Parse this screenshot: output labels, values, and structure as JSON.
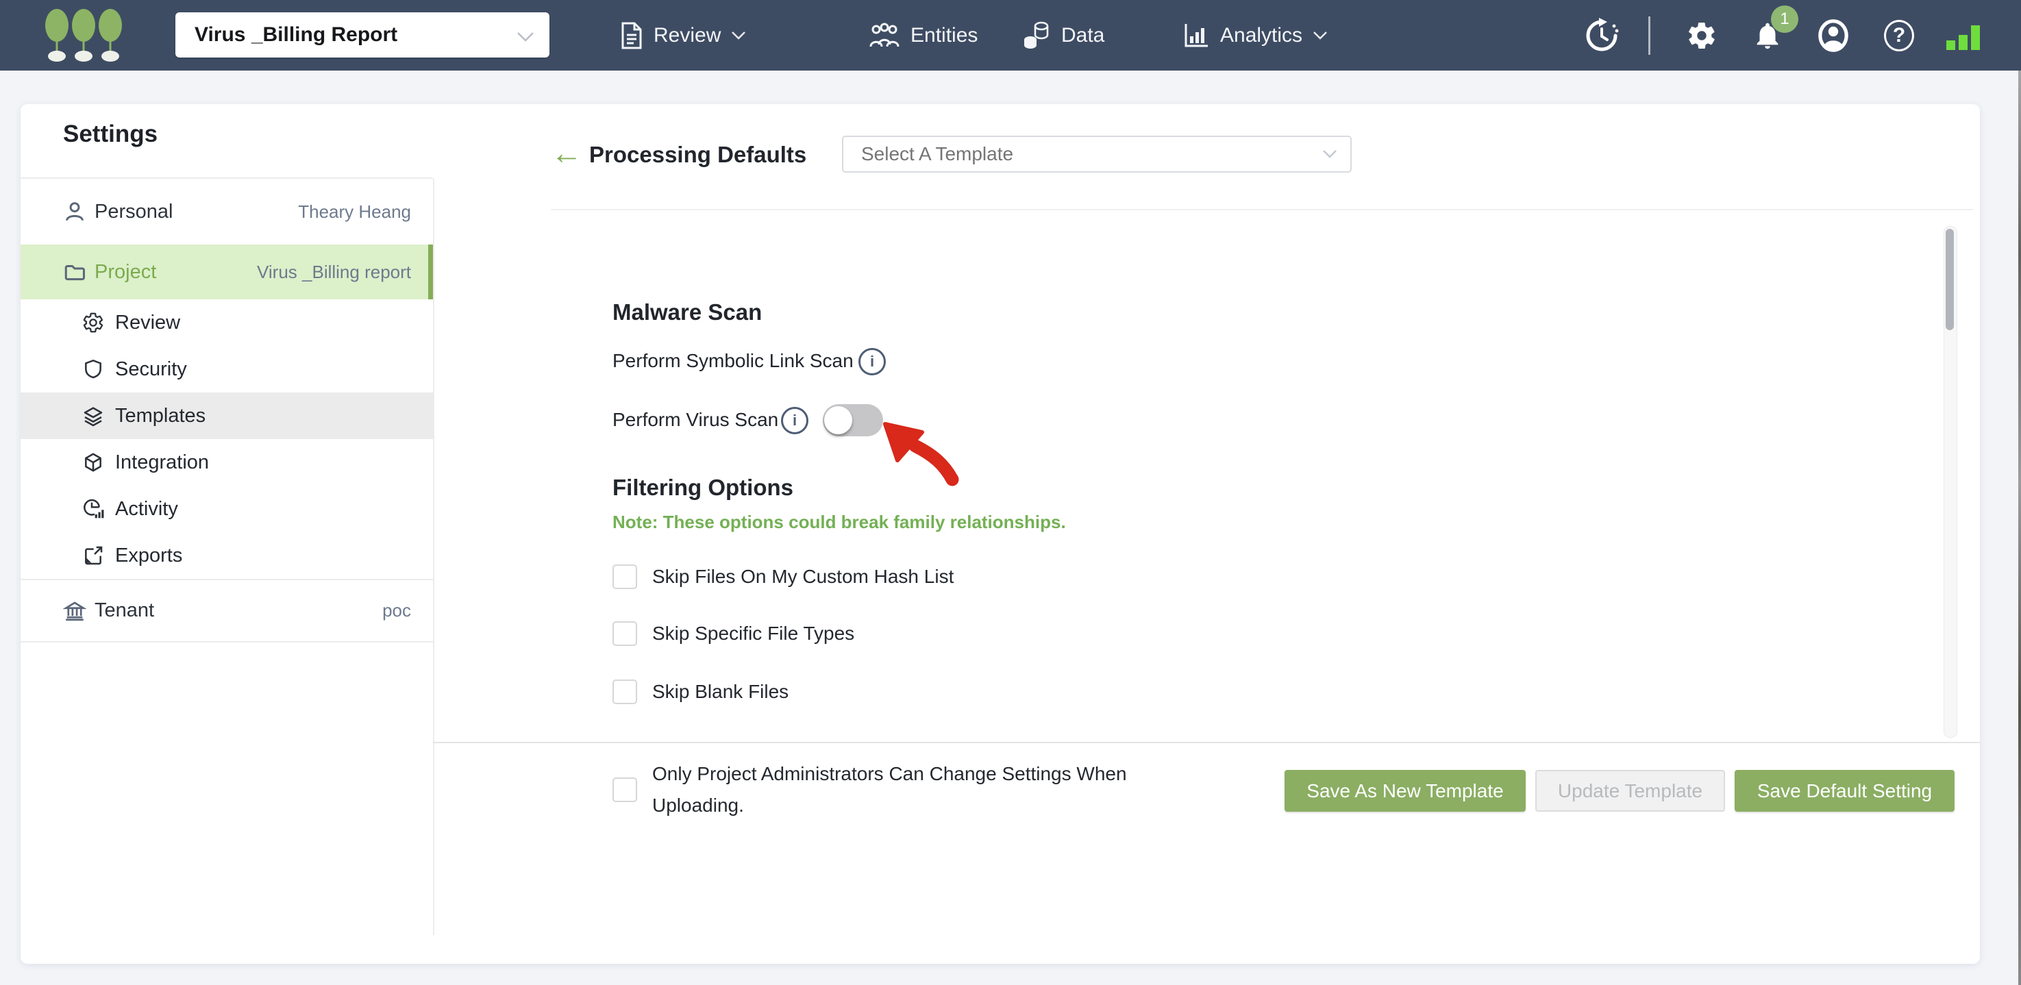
{
  "top_bar": {
    "project_selector_value": "Virus _Billing Report",
    "nav": [
      "Review",
      "Entities",
      "Data",
      "Analytics"
    ],
    "notification_badge": "1"
  },
  "sidebar": {
    "title": "Settings",
    "personal": {
      "label": "Personal",
      "value": "Theary Heang"
    },
    "project": {
      "label": "Project",
      "value": "Virus _Billing report"
    },
    "subitems": [
      "Review",
      "Security",
      "Templates",
      "Integration",
      "Activity",
      "Exports"
    ],
    "tenant": {
      "label": "Tenant",
      "value": "poc"
    }
  },
  "main": {
    "title": "Processing Defaults",
    "template_dropdown_placeholder": "Select A Template",
    "malware": {
      "heading": "Malware Scan",
      "symbolic_label": "Perform Symbolic Link Scan",
      "virus_label": "Perform Virus Scan",
      "virus_toggle_state": "off"
    },
    "filtering": {
      "heading": "Filtering Options",
      "note": "Note: These options could break family relationships.",
      "options": [
        "Skip Files On My Custom Hash List",
        "Skip Specific File Types",
        "Skip Blank Files"
      ],
      "options_checked": [
        false,
        false,
        false
      ]
    },
    "footer": {
      "admin_label": "Only Project Administrators Can Change Settings When Uploading.",
      "admin_checked": false,
      "buttons": {
        "save_as_new": "Save As New Template",
        "update": "Update Template",
        "save_default": "Save Default Setting"
      }
    }
  },
  "icons": {
    "back_glyph": "←",
    "info_glyph": "i",
    "help_glyph": "?"
  },
  "colors": {
    "top_bar": "#3e4c63",
    "accent_green": "#8bae63",
    "sidebar_highlight": "#dcf0ca",
    "sidebar_highlight_text": "#7cab4e",
    "note_green": "#74b055",
    "arrow_red": "#d8291b",
    "badge_green": "#8fb873",
    "signal_green": "#6fdd3c",
    "page_background": "#f2f4f8"
  }
}
